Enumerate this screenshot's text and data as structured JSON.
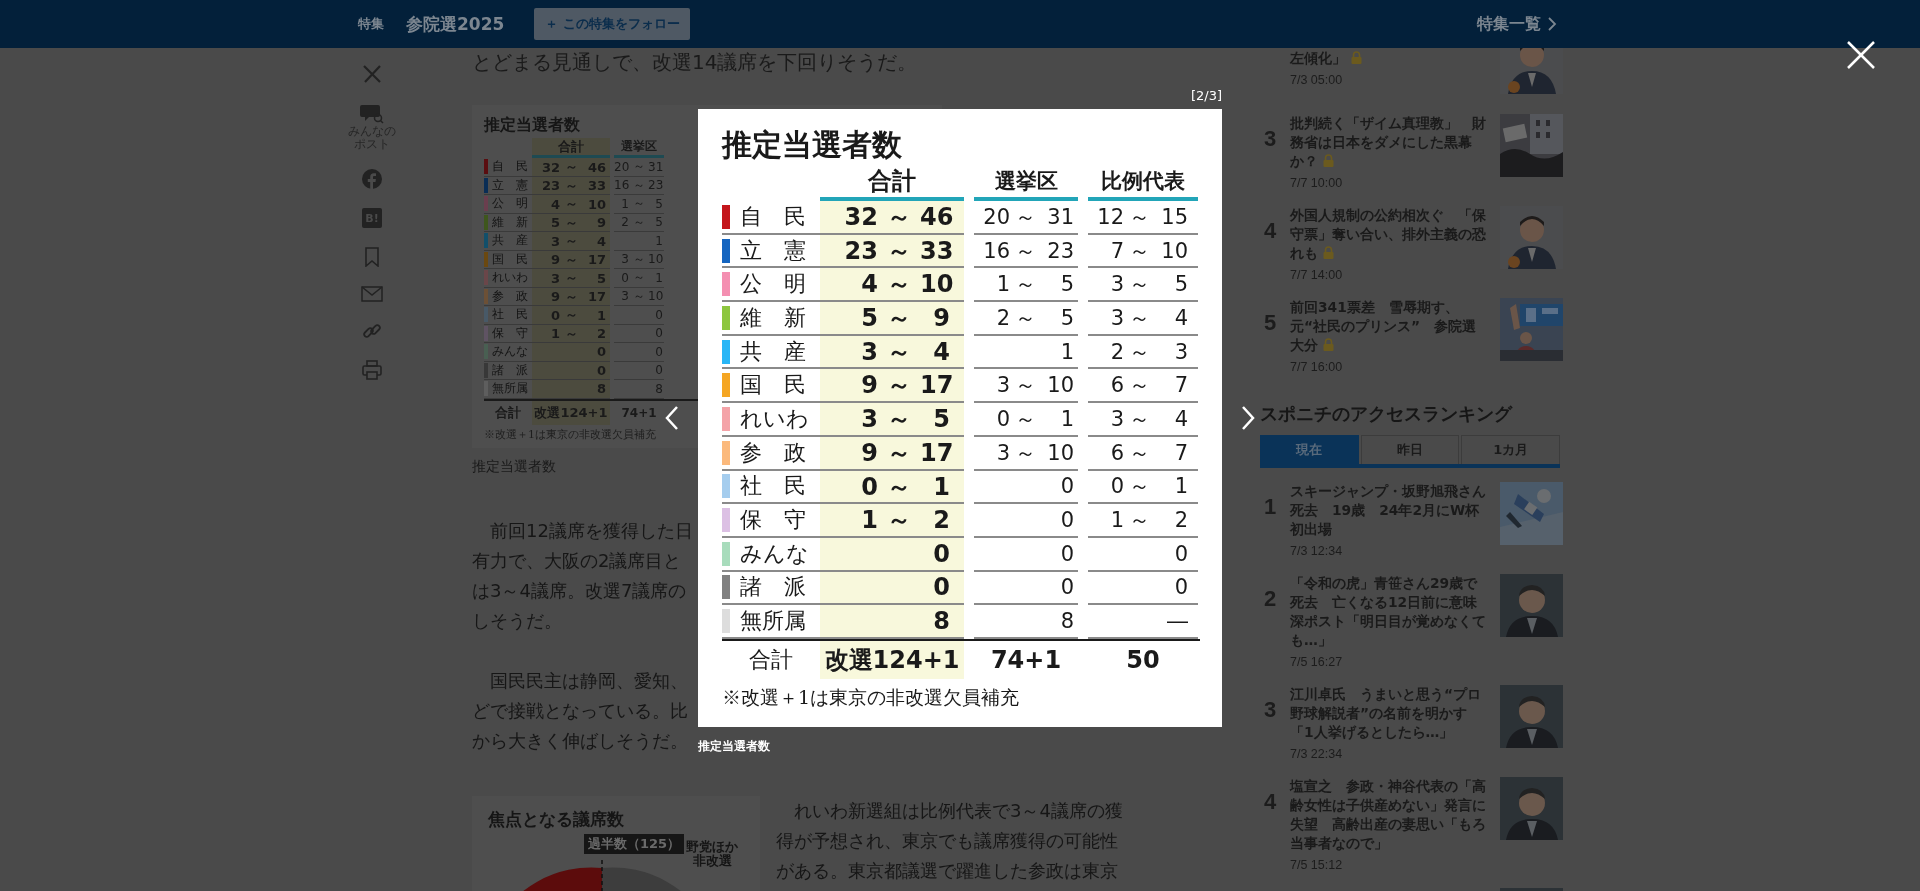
{
  "header": {
    "section": "特集",
    "title": "参院選2025",
    "follow_button": "＋ この特集をフォロー",
    "all_features_link": "特集一覧"
  },
  "share_bar": [
    {
      "kind": "x"
    },
    {
      "kind": "post",
      "label": "みんなのポスト"
    },
    {
      "kind": "facebook"
    },
    {
      "kind": "hatena",
      "label": "B!"
    },
    {
      "kind": "bookmark"
    },
    {
      "kind": "mail"
    },
    {
      "kind": "link"
    },
    {
      "kind": "print"
    }
  ],
  "article": {
    "lead_line": "とどまる見通しで、改選14議席を下回りそうだ。",
    "figure": {
      "title": "推定当選者数",
      "columns": [
        "合計",
        "選挙区"
      ],
      "rows": [
        {
          "party": "自　民",
          "color": "#5a0d10",
          "total": "32 ～ 46",
          "district": "20 ～ 31"
        },
        {
          "party": "立　憲",
          "color": "#0a2d55",
          "total": "23 ～ 33",
          "district": "16 ～ 23"
        },
        {
          "party": "公　明",
          "color": "#6a3e4e",
          "total": "4 ～ 10",
          "district": "1 ～ 5"
        },
        {
          "party": "維　新",
          "color": "#3e561c",
          "total": "5 ～ 9",
          "district": "2 ～ 5"
        },
        {
          "party": "共　産",
          "color": "#124f6a",
          "total": "3 ～ 4",
          "district": "1"
        },
        {
          "party": "国　民",
          "color": "#6a4810",
          "total": "9 ～ 17",
          "district": "3 ～ 10"
        },
        {
          "party": "れいわ",
          "color": "#6a4649",
          "total": "3 ～ 5",
          "district": "0 ～ 1"
        },
        {
          "party": "参　政",
          "color": "#6c5036",
          "total": "9 ～ 17",
          "district": "3 ～ 10"
        },
        {
          "party": "社　民",
          "color": "#485967",
          "total": "0 ～ 1",
          "district": "0"
        },
        {
          "party": "保　守",
          "color": "#5f5363",
          "total": "1 ～ 2",
          "district": "0"
        },
        {
          "party": "みんな",
          "color": "#495f52",
          "total": "0",
          "district": "0"
        },
        {
          "party": "諸　派",
          "color": "#383838",
          "total": "0",
          "district": "0"
        },
        {
          "party": "無所属",
          "color": "#5e5e5e",
          "total": "8",
          "district": "8"
        }
      ],
      "footer": {
        "label": "合計",
        "total": "改選124+1",
        "district": "74+1"
      },
      "note": "※改選＋1は東京の非改選欠員補充"
    },
    "figure_caption": "推定当選者数",
    "paragraphs": [
      [
        "　前回12議席を獲得した日",
        "有力で、大阪の2議席目と",
        "は3～4議席。改選7議席の",
        "しそうだ。"
      ],
      [
        "　国民民主は静岡、愛知、",
        "どで接戦となっている。比",
        "から大きく伸ばしそうだ。"
      ]
    ],
    "chart_figure": {
      "title": "焦点となる議席数",
      "majority_label": "過半数（125）",
      "side_label": "野党ほか非改選"
    },
    "side_paragraph": [
      "　れいわ新選組は比例代表で3～4議席の獲",
      "得が予想され、東京でも議席獲得の可能性",
      "がある。東京都議選で躍進した参政は東京"
    ]
  },
  "sidebar": {
    "feature_list": [
      {
        "title": "左傾化」",
        "locked": true,
        "date": "7/3 05:00",
        "thumbnail": {
          "kind": "picture"
        }
      },
      {
        "rank": "3",
        "title": "批判続く「ザイム真理教」　財務省は日本をダメにした黒幕か？",
        "locked": true,
        "date": "7/7 10:00",
        "thumbnail": {
          "kind": "picture"
        }
      },
      {
        "rank": "4",
        "title": "外国人規制の公約相次ぐ　「保守票」奪い合い、排外主義の恐れも",
        "locked": true,
        "date": "7/7 14:00",
        "thumbnail": {
          "kind": "picture"
        }
      },
      {
        "rank": "5",
        "title": "前回341票差　雪辱期す、元“社民のプリンス”　参院選大分",
        "locked": true,
        "date": "7/7 16:00",
        "thumbnail": {
          "kind": "picture"
        }
      }
    ],
    "ranking": {
      "heading": "スポニチのアクセスランキング",
      "tabs": [
        {
          "label": "現在",
          "selected": true
        },
        {
          "label": "昨日",
          "selected": false
        },
        {
          "label": "1カ月",
          "selected": false
        }
      ],
      "items": [
        {
          "rank": "1",
          "title": "スキージャンプ・坂野旭飛さん死去　19歳　24年2月にW杯初出場",
          "date": "7/3 12:34",
          "thumbnail": {
            "kind": "picture"
          }
        },
        {
          "rank": "2",
          "title": "「令和の虎」青笹さん29歳で死去　亡くなる12日前に意味深ポスト「明日目が覚めなくても…」",
          "date": "7/5 16:27",
          "thumbnail": {
            "kind": "picture"
          }
        },
        {
          "rank": "3",
          "title": "江川卓氏　うまいと思う“プロ野球解説者”の名前を明かす「1人挙げるとしたら…」",
          "date": "7/3 22:34",
          "thumbnail": {
            "kind": "picture"
          }
        },
        {
          "rank": "4",
          "title": "塩宣之　参政・神谷代表の「高齢女性は子供産めない」発言に失望　高齢出産の妻思い「もろ当事者なので」",
          "date": "7/5 15:12",
          "thumbnail": {
            "kind": "picture"
          }
        },
        {
          "thumbnail": {
            "kind": "picture"
          }
        }
      ]
    }
  },
  "lightbox": {
    "counter": "[2/3]",
    "caption": "推定当選者数",
    "image_table": {
      "title": "推定当選者数",
      "columns": [
        "合計",
        "選挙区",
        "比例代表"
      ],
      "rows": [
        {
          "party": "自　民",
          "color": "#c4161c",
          "total": "32 ～ 46",
          "district": "20 ～ 31",
          "proportional": "12 ～ 15"
        },
        {
          "party": "立　憲",
          "color": "#1565c0",
          "total": "23 ～ 33",
          "district": "16 ～ 23",
          "proportional": "7 ～ 10"
        },
        {
          "party": "公　明",
          "color": "#f48fb1",
          "total": "4 ～ 10",
          "district": "1 ～ 5",
          "proportional": "3 ～ 5"
        },
        {
          "party": "維　新",
          "color": "#8dc63f",
          "total": "5 ～ 9",
          "district": "2 ～ 5",
          "proportional": "3 ～ 4"
        },
        {
          "party": "共　産",
          "color": "#29b6f6",
          "total": "3 ～ 4",
          "district": "1",
          "proportional": "2 ～ 3"
        },
        {
          "party": "国　民",
          "color": "#f5a623",
          "total": "9 ～ 17",
          "district": "3 ～ 10",
          "proportional": "6 ～ 7"
        },
        {
          "party": "れいわ",
          "color": "#f4a3a8",
          "total": "3 ～ 5",
          "district": "0 ～ 1",
          "proportional": "3 ～ 4"
        },
        {
          "party": "参　政",
          "color": "#fbb97c",
          "total": "9 ～ 17",
          "district": "3 ～ 10",
          "proportional": "6 ～ 7"
        },
        {
          "party": "社　民",
          "color": "#a5cdee",
          "total": "0 ～ 1",
          "district": "0",
          "proportional": "0 ～ 1"
        },
        {
          "party": "保　守",
          "color": "#dcc0e4",
          "total": "1 ～ 2",
          "district": "0",
          "proportional": "1 ～ 2"
        },
        {
          "party": "みんな",
          "color": "#a8dcbc",
          "total": "0",
          "district": "0",
          "proportional": "0"
        },
        {
          "party": "諸　派",
          "color": "#808080",
          "total": "0",
          "district": "0",
          "proportional": "0"
        },
        {
          "party": "無所属",
          "color": "#dddddd",
          "total": "8",
          "district": "8",
          "proportional": "―"
        }
      ],
      "footer": {
        "label": "合計",
        "total": "改選124+1",
        "district": "74+1",
        "proportional": "50"
      },
      "note": "※改選＋1は東京の非改選欠員補充"
    }
  }
}
